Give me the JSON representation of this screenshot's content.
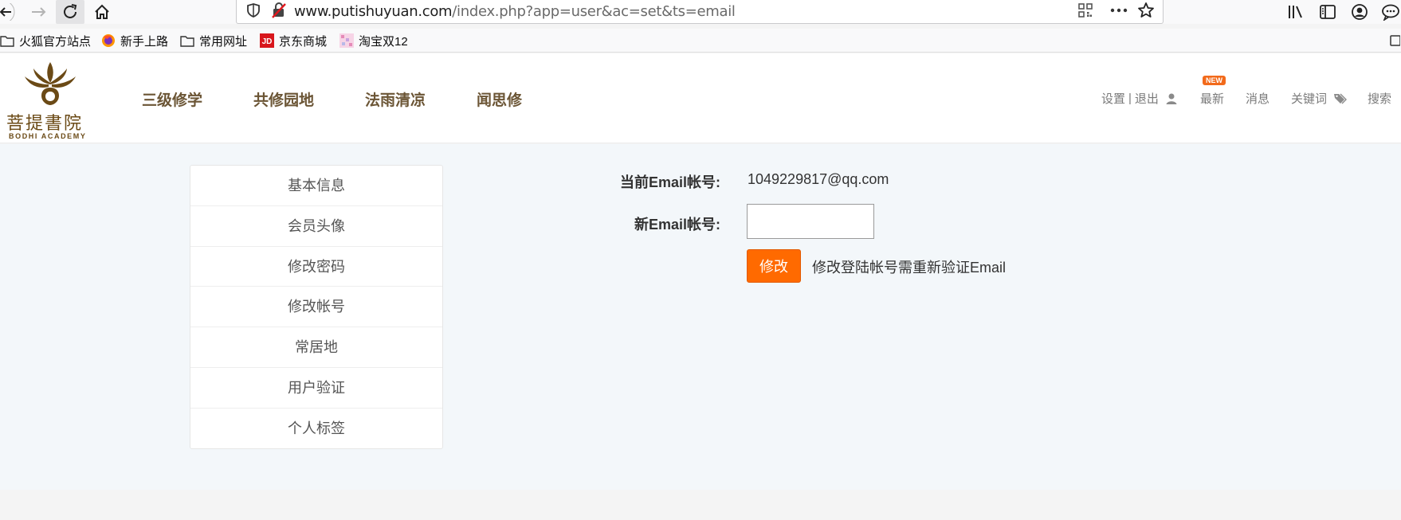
{
  "browser": {
    "url_host": "www.putishuyuan.com",
    "url_path": "/index.php?app=user&ac=set&ts=email",
    "bookmarks": [
      {
        "label": "火狐官方站点",
        "icon": "folder-icon"
      },
      {
        "label": "新手上路",
        "icon": "firefox-icon"
      },
      {
        "label": "常用网址",
        "icon": "folder-icon"
      },
      {
        "label": "京东商城",
        "icon": "jd-icon"
      },
      {
        "label": "淘宝双12",
        "icon": "taobao-icon"
      }
    ]
  },
  "site": {
    "logo_cn": "菩提書院",
    "logo_en": "BODHI ACADEMY",
    "nav": [
      "三级修学",
      "共修园地",
      "法雨清凉",
      "闻思修"
    ],
    "top_links": {
      "settings": "设置",
      "separator": "|",
      "logout": "退出",
      "latest": "最新",
      "new_badge": "NEW",
      "messages": "消息",
      "keywords": "关键词",
      "search": "搜索"
    },
    "accent_color": "#ff6a00"
  },
  "sidebar": {
    "items": [
      "基本信息",
      "会员头像",
      "修改密码",
      "修改帐号",
      "常居地",
      "用户验证",
      "个人标签"
    ]
  },
  "form": {
    "current_label": "当前Email帐号:",
    "current_value": "1049229817@qq.com",
    "new_label": "新Email帐号:",
    "new_value": "",
    "submit_label": "修改",
    "hint": "修改登陆帐号需重新验证Email"
  }
}
